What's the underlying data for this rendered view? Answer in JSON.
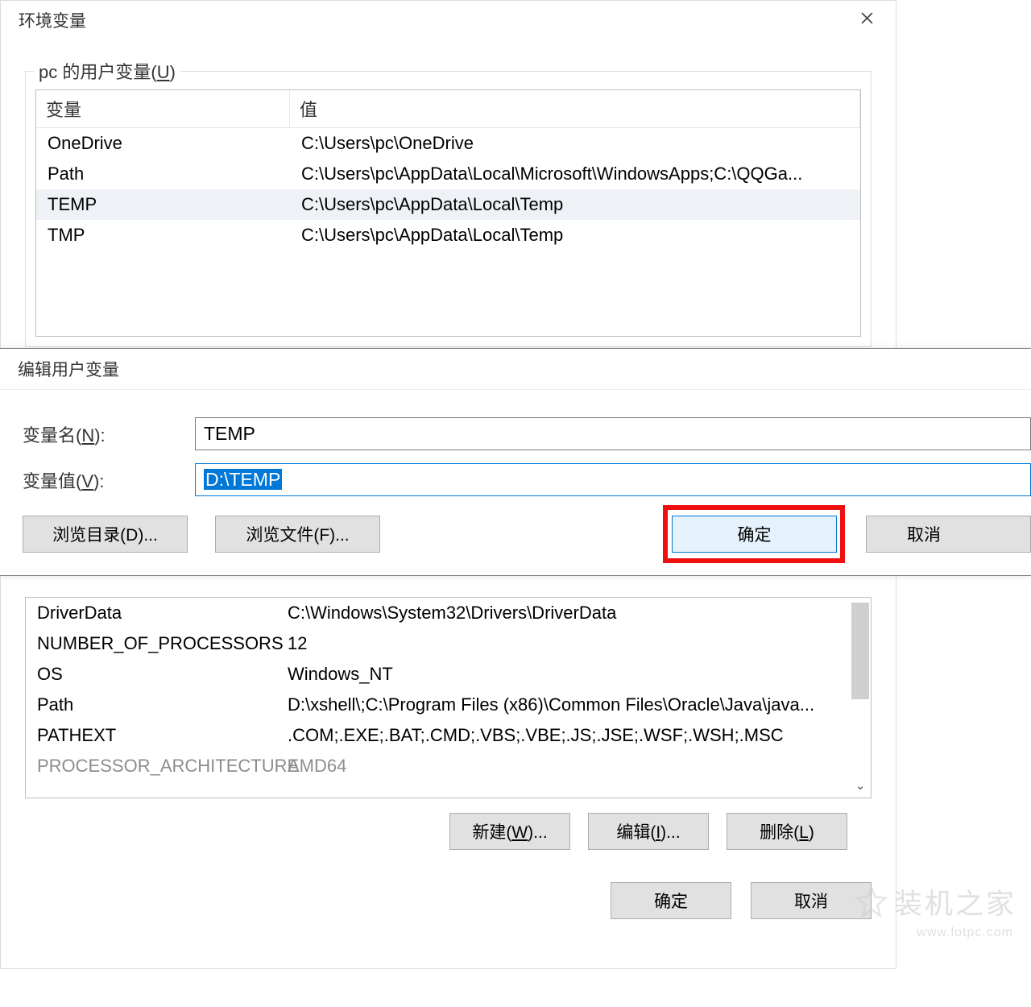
{
  "main": {
    "title": "环境变量",
    "close": "×"
  },
  "user_vars": {
    "legend_prefix": "pc 的用户变量(",
    "legend_key": "U",
    "legend_suffix": ")",
    "headers": {
      "var": "变量",
      "val": "值"
    },
    "rows": [
      {
        "var": "OneDrive",
        "val": "C:\\Users\\pc\\OneDrive"
      },
      {
        "var": "Path",
        "val": "C:\\Users\\pc\\AppData\\Local\\Microsoft\\WindowsApps;C:\\QQGa..."
      },
      {
        "var": "TEMP",
        "val": "C:\\Users\\pc\\AppData\\Local\\Temp"
      },
      {
        "var": "TMP",
        "val": "C:\\Users\\pc\\AppData\\Local\\Temp"
      }
    ]
  },
  "edit_dialog": {
    "title": "编辑用户变量",
    "name_label_prefix": "变量名(",
    "name_label_key": "N",
    "name_label_suffix": "):",
    "name_value": "TEMP",
    "value_label_prefix": "变量值(",
    "value_label_key": "V",
    "value_label_suffix": "):",
    "value_value": "D:\\TEMP",
    "browse_dir": "浏览目录(D)...",
    "browse_file": "浏览文件(F)...",
    "ok": "确定",
    "cancel": "取消"
  },
  "sys_vars": {
    "rows": [
      {
        "var": "DriverData",
        "val": "C:\\Windows\\System32\\Drivers\\DriverData"
      },
      {
        "var": "NUMBER_OF_PROCESSORS",
        "val": "12"
      },
      {
        "var": "OS",
        "val": "Windows_NT"
      },
      {
        "var": "Path",
        "val": "D:\\xshell\\;C:\\Program Files (x86)\\Common Files\\Oracle\\Java\\java..."
      },
      {
        "var": "PATHEXT",
        "val": ".COM;.EXE;.BAT;.CMD;.VBS;.VBE;.JS;.JSE;.WSF;.WSH;.MSC"
      },
      {
        "var": "PROCESSOR_ARCHITECTURE",
        "val": "AMD64"
      }
    ]
  },
  "buttons": {
    "new_prefix": "新建(",
    "new_key": "W",
    "new_suffix": ")...",
    "edit_prefix": "编辑(",
    "edit_key": "I",
    "edit_suffix": ")...",
    "del_prefix": "删除(",
    "del_key": "L",
    "del_suffix": ")",
    "ok": "确定",
    "cancel": "取消"
  },
  "watermark": {
    "text": "装机之家",
    "url": "www.lotpc.com"
  }
}
